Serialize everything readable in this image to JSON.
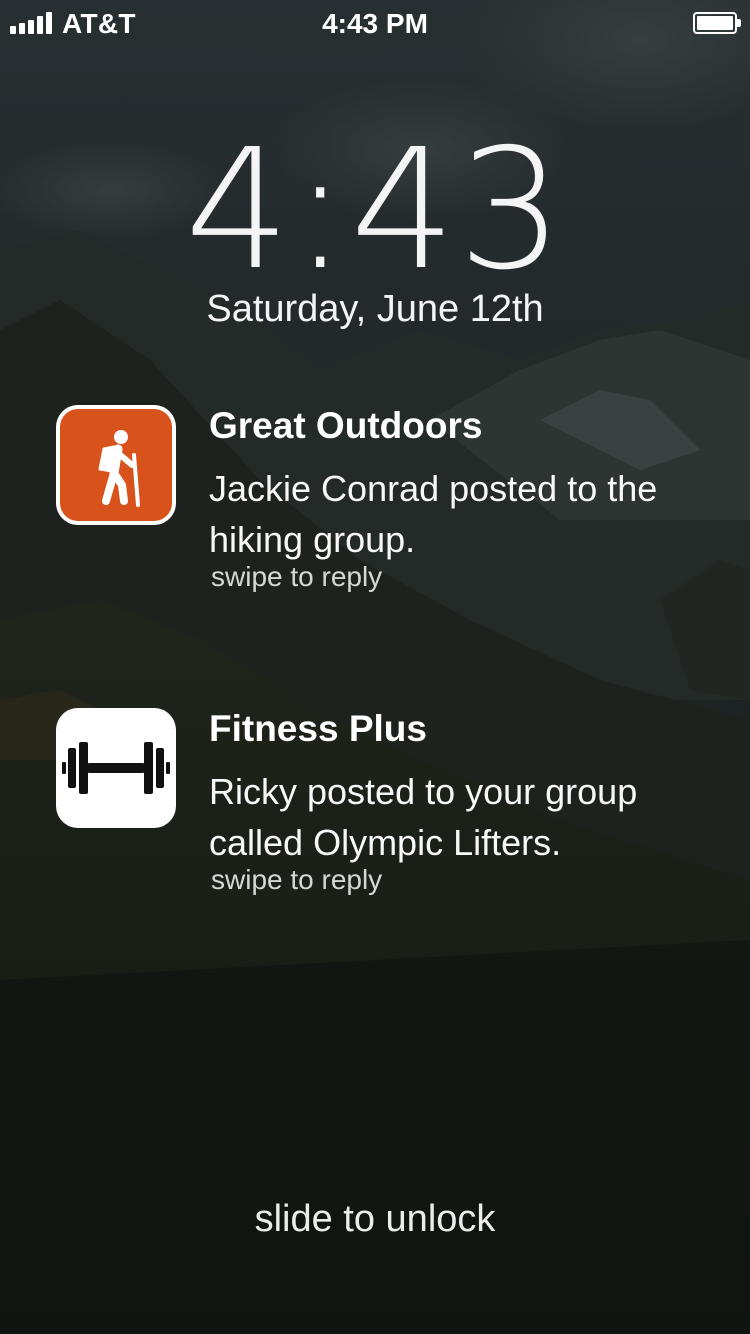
{
  "status_bar": {
    "carrier": "AT&T",
    "time": "4:43 PM",
    "signal_bars": 5,
    "battery_level": 1.0
  },
  "lock_screen": {
    "clock": "4:43",
    "date": "Saturday, June 12th",
    "unlock_hint": "slide to unlock"
  },
  "notifications": [
    {
      "app": "Great Outdoors",
      "icon": "hiker-icon",
      "icon_color": "#d8531b",
      "message": "Jackie Conrad posted to the hiking group.",
      "hint": "swipe to reply"
    },
    {
      "app": "Fitness Plus",
      "icon": "dumbbell-icon",
      "icon_color": "#ffffff",
      "message": "Ricky posted to your group called Olympic Lifters.",
      "hint": "swipe to reply"
    }
  ]
}
